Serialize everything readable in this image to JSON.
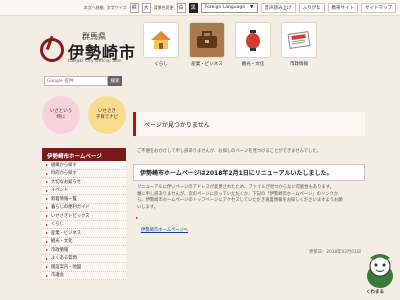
{
  "topbar": {
    "char_spacing_label": "本文へ移動",
    "font_size_label": "文字サイズ",
    "font_std": "標",
    "font_large": "大",
    "bg_color_label": "背景色変更",
    "bg_white": "白",
    "bg_black": "黒",
    "language_select": "Foreign Language",
    "language_caret": "▼",
    "links": [
      "音声読み上げ",
      "ふりがな",
      "携帯サイト",
      "サイトマップ"
    ]
  },
  "logo": {
    "prefecture": "群馬県",
    "city": "伊勢崎市",
    "english": "Isesaki City Official Site"
  },
  "nav_tiles": [
    {
      "label": "くらし",
      "icon": "house-icon"
    },
    {
      "label": "産業・ビジネス",
      "icon": "briefcase-icon"
    },
    {
      "label": "観光・文化",
      "icon": "lantern-icon"
    },
    {
      "label": "市政情報",
      "icon": "newspaper-icon"
    }
  ],
  "search": {
    "placeholder": "Google 提供",
    "button": "検索"
  },
  "circles": [
    {
      "label": "いざという\n時に"
    },
    {
      "label": "いせさき\n子育てナビ"
    }
  ],
  "sidebar": {
    "heading": "伊勢崎市ホームページ",
    "items": [
      "組織から探す",
      "目的から探す",
      "大切なお知らせ",
      "イベント",
      "新着情報一覧",
      "暮らしの便利ガイド",
      "いせさきトピックス",
      "くらし",
      "産業・ビジネス",
      "観光・文化",
      "市政情報",
      "よくある質問",
      "施設案内・地図",
      "市議会"
    ]
  },
  "main": {
    "page_title": "ページが見つかりません",
    "message": "ご不便をおかけして申し訳ありませんが、お探しのページを見つけることができませんでした。",
    "notice_title": "伊勢崎市ホームページは2018年2月1日にリニューアルいたしました。",
    "notice_body": "リニューアルに伴いページのアドレスが変更されたため、ファイルが見つからない可能性もあります。\n順に申し訳ありませんが、次のページに戻っていただくか、下記の「伊勢崎市ホームページ」のリンクか\nら、伊勢崎市ホームページのトップページにアクセスしていただき再度情報をお探しくださいますようお願\nいします。",
    "home_link": "伊勢崎市ホームページへ",
    "updated": "更新日：2018年02月01日"
  },
  "mascot": {
    "name": "くわまる"
  },
  "colors": {
    "accent": "#8b1a1a",
    "heading_bar": "#c40a0a",
    "background": "#f3ede3"
  }
}
